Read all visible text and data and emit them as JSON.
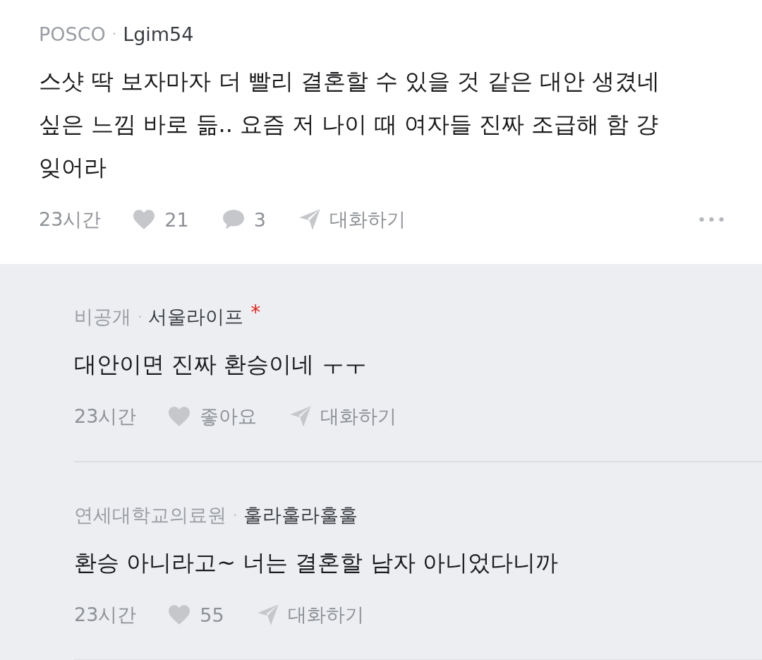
{
  "comment": {
    "company": "POSCO",
    "separator": "·",
    "author": "Lgim54",
    "body": "스샷 딱 보자마자 더 빨리 결혼할 수 있을 것 같은 대안 생겼네\n싶은 느낌 바로 듦.. 요즘 저 나이 때 여자들 진짜 조급해 함 걍\n잊어라",
    "time": "23시간",
    "likes": "21",
    "replies": "3",
    "reply_label": "대화하기",
    "more": "•••"
  },
  "replies": [
    {
      "company": "비공개",
      "separator": "·",
      "author": "서울라이프",
      "marker": "*",
      "body": "대안이면 진짜 환승이네 ㅜㅜ",
      "time": "23시간",
      "likes": "좋아요",
      "reply_label": "대화하기"
    },
    {
      "company": "연세대학교의료원",
      "separator": "·",
      "author": "훌라훌라훌훌",
      "body": "환승 아니라고~ 너는 결혼할 남자 아니었다니까",
      "time": "23시간",
      "likes": "55",
      "reply_label": "대화하기"
    }
  ]
}
